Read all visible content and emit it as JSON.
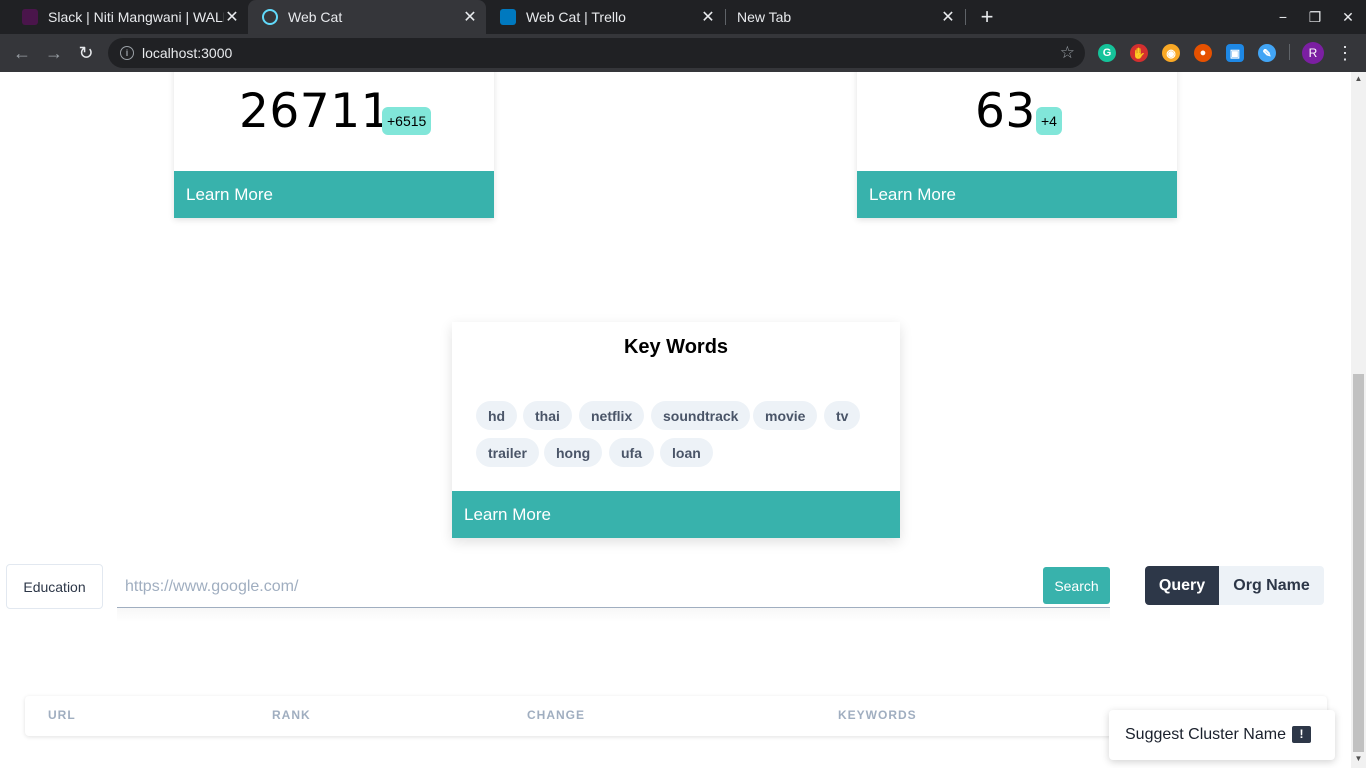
{
  "browser": {
    "tabs": [
      {
        "title": "Slack | Niti Mangwani | WALL",
        "favicon_color": "#4a154b"
      },
      {
        "title": "Web Cat",
        "favicon_color": "#61dafb"
      },
      {
        "title": "Web Cat | Trello",
        "favicon_color": "#0079bf"
      },
      {
        "title": "New Tab",
        "favicon_color": ""
      }
    ],
    "new_tab_symbol": "+",
    "url": "localhost:3000",
    "profile_initial": "R",
    "window_controls": {
      "minimize": "−",
      "restore": "❐",
      "close": "✕"
    }
  },
  "stats": [
    {
      "value": "26711",
      "delta": "+6515",
      "learn_more": "Learn More"
    },
    {
      "value": "63",
      "delta": "+4",
      "learn_more": "Learn More"
    }
  ],
  "keywords_card": {
    "title": "Key Words",
    "chips": [
      "hd",
      "thai",
      "netflix",
      "soundtrack",
      "movie",
      "tv",
      "trailer",
      "hong",
      "ufa",
      "loan"
    ],
    "learn_more": "Learn More"
  },
  "search": {
    "category_label": "Education",
    "placeholder": "https://www.google.com/",
    "button_label": "Search",
    "toggle": {
      "query": "Query",
      "org_name": "Org Name",
      "selected": "Query"
    }
  },
  "table": {
    "headers": [
      "URL",
      "RANK",
      "CHANGE",
      "KEYWORDS"
    ]
  },
  "suggest_button": {
    "label": "Suggest Cluster Name",
    "icon": "feedback-icon"
  },
  "colors": {
    "accent": "#38b2ac",
    "badge": "#81e6d9",
    "dark": "#2d3748",
    "chip_bg": "#edf2f7"
  }
}
